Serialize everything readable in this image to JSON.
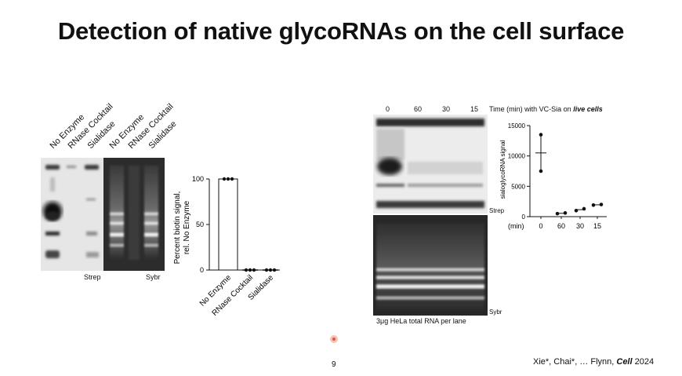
{
  "slide": {
    "title": "Detection of native glycoRNAs on the cell surface",
    "page_number": "9",
    "citation_prefix": "Xie*, Chai*, … Flynn, ",
    "citation_journal": "Cell",
    "citation_year": " 2024"
  },
  "left_panel": {
    "lane_labels": [
      "No Enzyme",
      "RNase Cocktail",
      "Sialidase",
      "No Enzyme",
      "RNase Cocktail",
      "Sialidase"
    ],
    "strep_label": "Strep",
    "sybr_label": "Sybr",
    "bar_chart": {
      "type": "bar",
      "categories": [
        "No Enzyme",
        "RNase Cocktail",
        "Sialidase"
      ],
      "values": [
        100,
        0,
        0
      ],
      "points": [
        [
          100,
          100,
          100
        ],
        [
          0,
          0,
          0
        ],
        [
          0,
          0,
          0
        ]
      ],
      "ylabel_line1": "Percent biotin signal,",
      "ylabel_line2": "rel. No Enzyme",
      "yticks": [
        "0",
        "50",
        "100"
      ],
      "ylim": [
        0,
        100
      ]
    }
  },
  "right_panel": {
    "time_labels": [
      "0",
      "60",
      "30",
      "15"
    ],
    "time_caption_prefix": "Time (min) with VC-Sia on ",
    "time_caption_emph": "live cells",
    "strep_label": "Strep",
    "sybr_label": "Sybr",
    "gel_caption": "3μg HeLa total RNA per lane",
    "scatter_chart": {
      "type": "scatter",
      "ylabel": "sialoglycoRNA signal",
      "xlabel_prefix": "(min)",
      "categories": [
        "0",
        "60",
        "30",
        "15"
      ],
      "points": [
        [
          13500,
          7500
        ],
        [
          500,
          600
        ],
        [
          1000,
          1300
        ],
        [
          1900,
          2000
        ]
      ],
      "means": [
        10500,
        550,
        1150,
        1950
      ],
      "yticks": [
        "0",
        "5000",
        "10000",
        "15000"
      ],
      "ylim": [
        0,
        15000
      ]
    }
  }
}
